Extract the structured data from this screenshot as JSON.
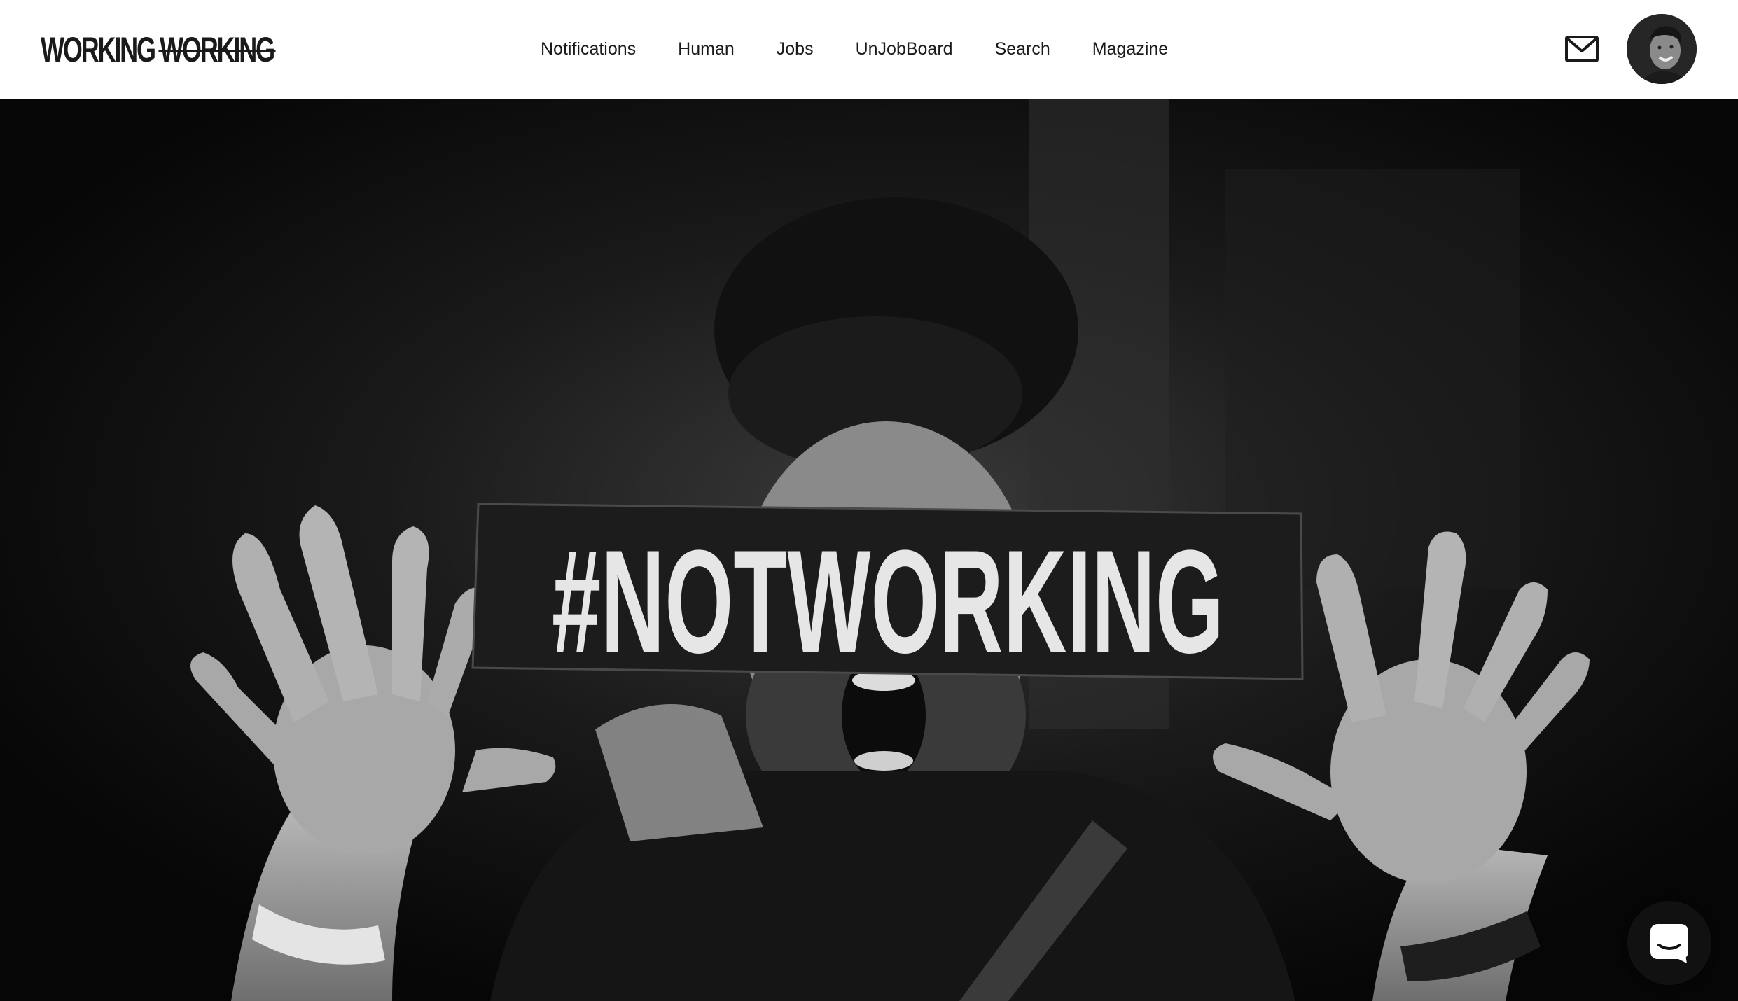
{
  "header": {
    "logo_text": "WORKING",
    "logo_text_struck": "WORKING",
    "nav": [
      {
        "label": "Notifications"
      },
      {
        "label": "Human"
      },
      {
        "label": "Jobs"
      },
      {
        "label": "UnJobBoard"
      },
      {
        "label": "Search"
      },
      {
        "label": "Magazine"
      }
    ],
    "mail_icon": "envelope-icon",
    "avatar_icon": "user-avatar"
  },
  "hero": {
    "sign_text": "#NOTWORKING",
    "image_desc_icon": "hero-photo"
  },
  "chat": {
    "icon": "chat-bubble-icon"
  },
  "colors": {
    "header_bg": "#ffffff",
    "text": "#1a1a1a",
    "hero_bg": "#0a0a0a"
  }
}
